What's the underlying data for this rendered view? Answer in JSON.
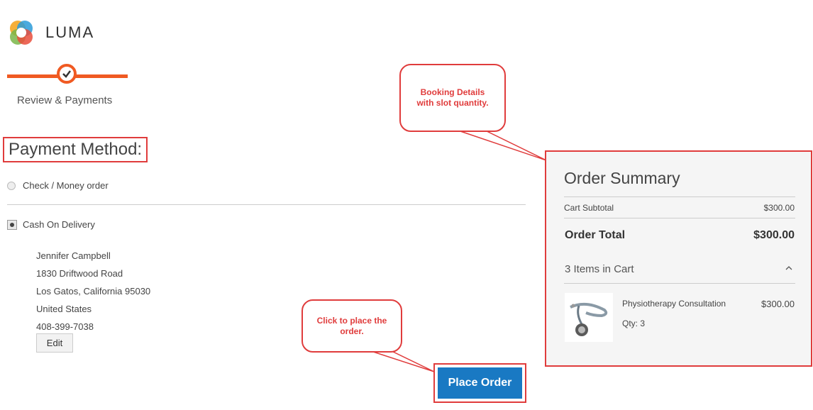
{
  "header": {
    "logo_text": "LUMA"
  },
  "progress": {
    "step_label": "Review & Payments"
  },
  "payment": {
    "title": "Payment Method:",
    "options": [
      "Check / Money order",
      "Cash On Delivery"
    ],
    "selected": "Cash On Delivery",
    "address": {
      "name": "Jennifer Campbell",
      "street": "1830 Driftwood Road",
      "city": "Los Gatos, California 95030",
      "country": "United States",
      "phone": "408-399-7038"
    },
    "edit_label": "Edit",
    "place_order_label": "Place Order"
  },
  "callouts": {
    "booking": [
      "Booking Details",
      "with slot quantity."
    ],
    "place": [
      "Click to place the",
      "order."
    ]
  },
  "summary": {
    "title": "Order Summary",
    "subtotal_label": "Cart Subtotal",
    "subtotal_value": "$300.00",
    "total_label": "Order Total",
    "total_value": "$300.00",
    "items_label": "3 Items in Cart",
    "product": {
      "name": "Physiotherapy Consultation",
      "price": "$300.00",
      "qty": "Qty: 3"
    }
  },
  "colors": {
    "accent": "#f05a22",
    "button": "#1979c3",
    "highlight": "#e03c3c"
  }
}
